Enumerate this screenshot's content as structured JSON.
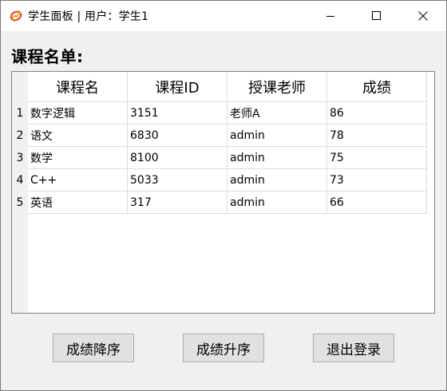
{
  "window": {
    "title": "学生面板 | 用户：学生1",
    "accent_color": "#e8501e"
  },
  "section": {
    "title": "课程名单:"
  },
  "table": {
    "headers": [
      "课程名",
      "课程ID",
      "授课老师",
      "成绩"
    ],
    "rows": [
      {
        "num": "1",
        "cells": [
          "数字逻辑",
          "3151",
          "老师A",
          "86"
        ]
      },
      {
        "num": "2",
        "cells": [
          "语文",
          "6830",
          "admin",
          "78"
        ]
      },
      {
        "num": "3",
        "cells": [
          "数学",
          "8100",
          "admin",
          "75"
        ]
      },
      {
        "num": "4",
        "cells": [
          "C++",
          "5033",
          "admin",
          "73"
        ]
      },
      {
        "num": "5",
        "cells": [
          "英语",
          "317",
          "admin",
          "66"
        ]
      }
    ]
  },
  "buttons": {
    "sort_desc": "成绩降序",
    "sort_asc": "成绩升序",
    "logout": "退出登录"
  }
}
